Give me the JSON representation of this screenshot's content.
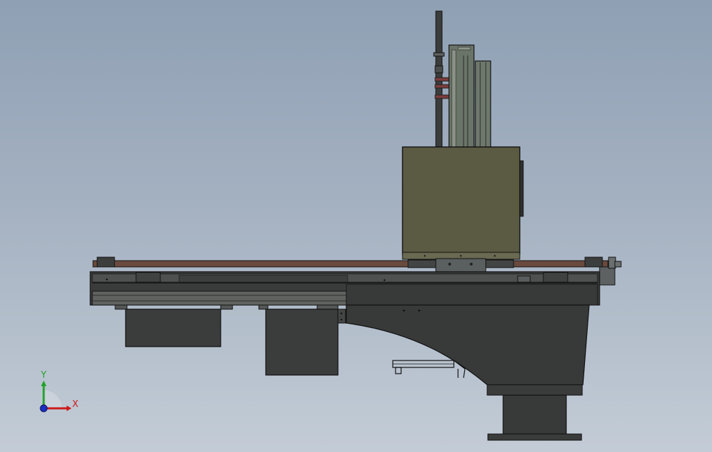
{
  "viewport": {
    "background_top": "#8fa0b4",
    "background_bottom": "#c3ccd6"
  },
  "model": {
    "colors": {
      "frame_dark": "#3a3b3b",
      "frame_mid": "#555753",
      "rail_brown": "#6a4a3e",
      "carriage_olive": "#5b5a42",
      "column_green": "#6b7468",
      "edge": "#111111"
    }
  },
  "triad": {
    "x_label": "X",
    "y_label": "Y",
    "x_color": "#cc1b1b",
    "y_color": "#22a22a",
    "z_color": "#1a2ec0"
  }
}
